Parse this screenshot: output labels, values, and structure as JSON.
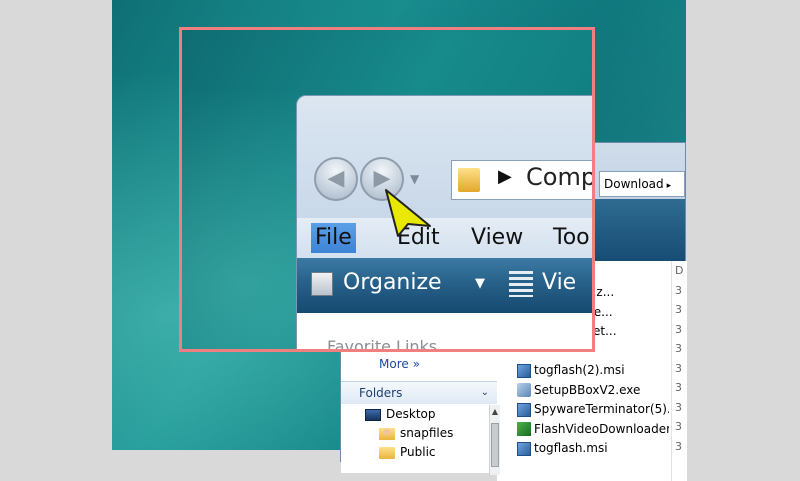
{
  "explorer": {
    "address": {
      "segment": "Download",
      "arrow": "▸"
    },
    "nav": {
      "more_label": "More",
      "more_arrows": "»",
      "folders_label": "Folders",
      "folders_chevron": "⌄"
    },
    "tree": [
      {
        "label": "Desktop",
        "icon": "desktop-icon"
      },
      {
        "label": "snapfiles",
        "icon": "user-folder-icon"
      },
      {
        "label": "Public",
        "icon": "folder-icon"
      }
    ],
    "files": [
      {
        "name": "Pro_setup.z...",
        "icon": "zip-icon"
      },
      {
        "name": "y_advisor.e...",
        "icon": "exe-icon"
      },
      {
        "name": "onverterSet...",
        "icon": "exe-icon"
      },
      {
        "name": "",
        "icon": ""
      },
      {
        "name": "togflash(2).msi",
        "icon": "msi-icon"
      },
      {
        "name": "SetupBBoxV2.exe",
        "icon": "exe-icon"
      },
      {
        "name": "SpywareTerminator(5)....",
        "icon": "msi-icon"
      },
      {
        "name": "FlashVideoDownloader....",
        "icon": "flashvideo-icon"
      },
      {
        "name": "togflash.msi",
        "icon": "msi-icon"
      }
    ],
    "column_header": "D",
    "column_values": [
      "3",
      "3",
      "3",
      "3",
      "3",
      "3",
      "3",
      "3",
      "3"
    ]
  },
  "zoom": {
    "address_text": "Comp",
    "address_arrow": "▶",
    "menu": [
      {
        "label": "File",
        "highlighted": true
      },
      {
        "label": "Edit",
        "highlighted": false
      },
      {
        "label": "View",
        "highlighted": false
      },
      {
        "label": "Too",
        "highlighted": false
      }
    ],
    "toolbar": {
      "organize_label": "Organize",
      "organize_drop": "▼",
      "views_label": "Vie"
    },
    "faded_text": "Favorite Links"
  },
  "colors": {
    "zoom_border": "#f08080",
    "menu_highlight": "#4a90e2",
    "cursor_fill": "#e8e800"
  }
}
